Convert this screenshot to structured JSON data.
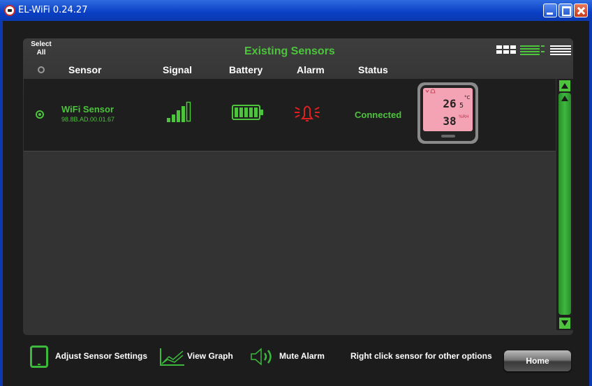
{
  "window": {
    "title": "EL-WiFi 0.24.27",
    "controls": [
      "minimize",
      "maximize",
      "close"
    ]
  },
  "panel": {
    "heading": "Existing Sensors",
    "select_all": "Select All",
    "view_modes": [
      "grid-view-icon",
      "list-view-icon",
      "compact-view-icon"
    ]
  },
  "columns": [
    "Sensor",
    "Signal",
    "Battery",
    "Alarm",
    "Status"
  ],
  "sensors": [
    {
      "name": "WiFi Sensor",
      "mac": "98.8B.AD.00.01.67",
      "signal_level": 5,
      "battery_level": 5,
      "alarm_icon": "alarm-bell-icon",
      "status": "Connected",
      "device_display": {
        "temperature": "26",
        "temp_decimal": "5",
        "temp_unit": "°C",
        "humidity": "38",
        "humidity_unit": "%RH"
      }
    }
  ],
  "toolbar": {
    "adjust_label": "Adjust Sensor Settings",
    "graph_label": "View Graph",
    "mute_label": "Mute Alarm",
    "hint": "Right click sensor for other options",
    "home_label": "Home"
  },
  "colors": {
    "accent_green": "#4cc43c",
    "alarm_red": "#e02020",
    "titlebar_blue": "#0a3fc4",
    "lcd_pink": "#f4a3b4"
  }
}
